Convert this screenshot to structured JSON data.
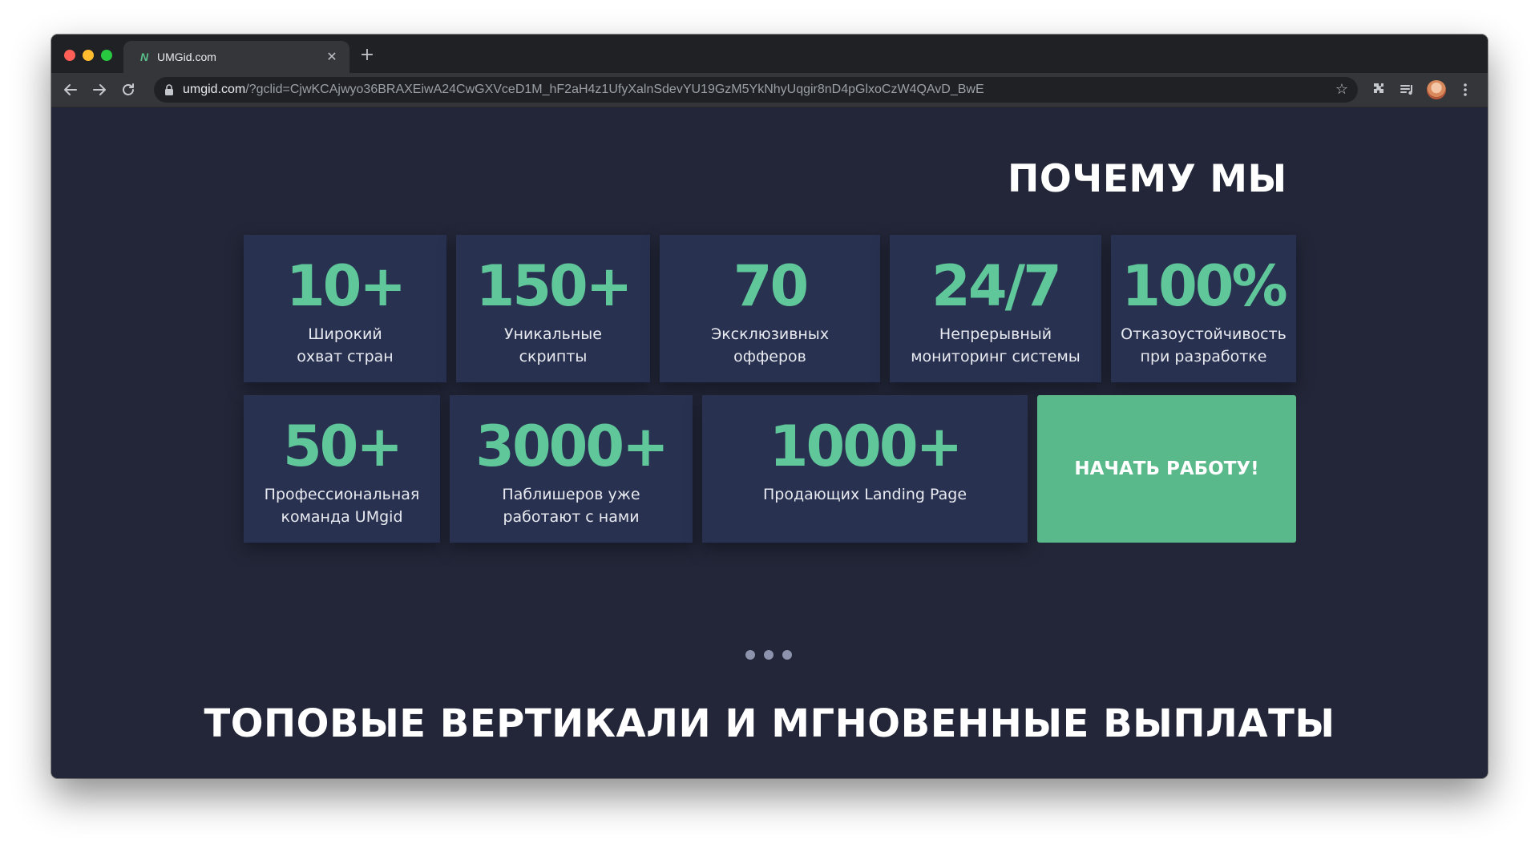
{
  "browser": {
    "tab": {
      "favicon_glyph": "N",
      "title": "UMGid.com",
      "close_glyph": "✕"
    },
    "new_tab_glyph": "+",
    "address_bar": {
      "host": "umgid.com",
      "path": "/?gclid=CjwKCAjwyo36BRAXEiwA24CwGXVceD1M_hF2aH4z1UfyXalnSdevYU19GzM5YkNhyUqgir8nD4pGlxoCzW4QAvD_BwE"
    },
    "bookmark_glyph": "☆"
  },
  "page": {
    "why_us_title": "ПОЧЕМУ МЫ",
    "stats_row1": [
      {
        "value": "10+",
        "label_line1": "Широкий",
        "label_line2": "охват стран"
      },
      {
        "value": "150+",
        "label_line1": "Уникальные",
        "label_line2": "скрипты"
      },
      {
        "value": "70",
        "label_line1": "Эксклюзивных",
        "label_line2": "офферов"
      },
      {
        "value": "24/7",
        "label_line1": "Непрерывный",
        "label_line2": "мониторинг системы"
      },
      {
        "value": "100%",
        "label_line1": "Отказоустойчивость",
        "label_line2": "при разработке"
      }
    ],
    "stats_row2": [
      {
        "value": "50+",
        "label_line1": "Профессиональная",
        "label_line2": "команда UMgid"
      },
      {
        "value": "3000+",
        "label_line1": "Паблишеров уже",
        "label_line2": "работают с нами"
      },
      {
        "value": "1000+",
        "label_line1": "Продающих Landing Page",
        "label_line2": ""
      }
    ],
    "cta_label": "НАЧАТЬ РАБОТУ!",
    "carousel_dots_count": 3,
    "verticals_title": "ТОПОВЫЕ ВЕРТИКАЛИ И МГНОВЕННЫЕ ВЫПЛАТЫ"
  },
  "colors": {
    "page_background": "#222638",
    "card_background": "#283150",
    "accent_green": "#5fc79a",
    "cta_background": "#5ab98a"
  }
}
